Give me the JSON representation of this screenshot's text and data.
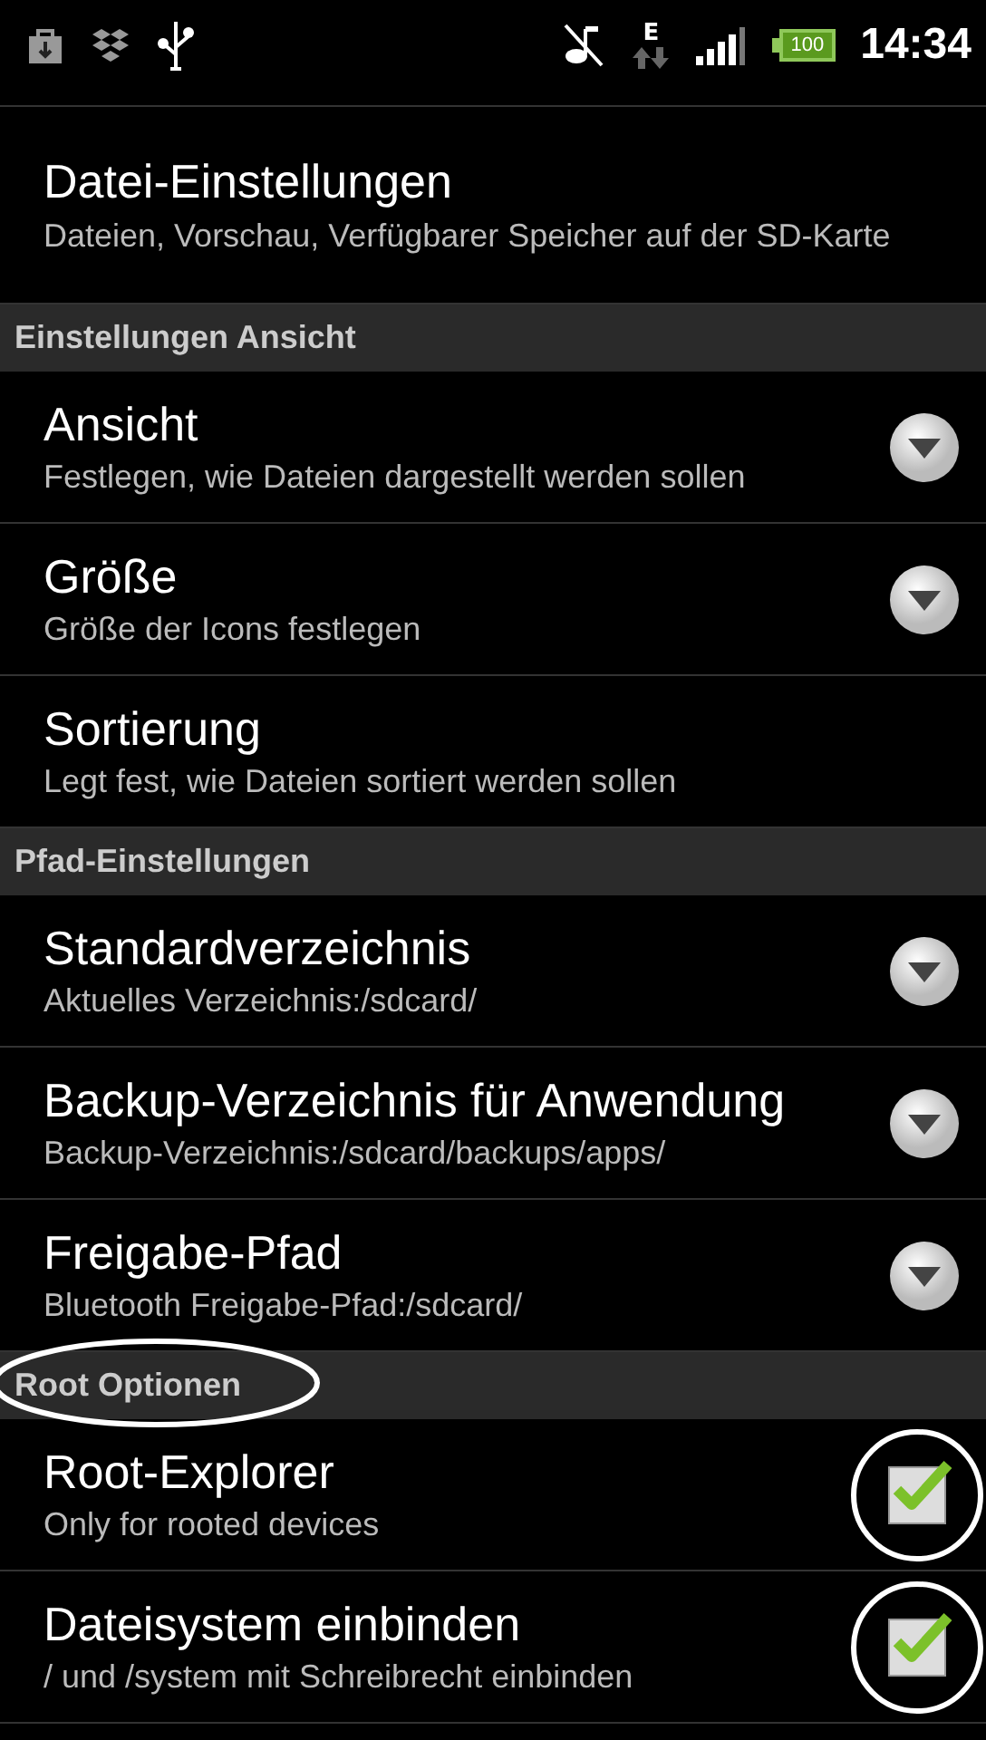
{
  "status_bar": {
    "network": "E",
    "battery": "100",
    "time": "14:34"
  },
  "items": [
    {
      "kind": "pref",
      "title": "Datei-Einstellungen",
      "summary": "Dateien, Vorschau, Verfügbarer Speicher auf der SD-Karte"
    },
    {
      "kind": "header",
      "title": "Einstellungen Ansicht",
      "circled": false
    },
    {
      "kind": "list",
      "title": "Ansicht",
      "summary": "Festlegen, wie Dateien dargestellt werden sollen"
    },
    {
      "kind": "list",
      "title": "Größe",
      "summary": "Größe der Icons festlegen"
    },
    {
      "kind": "pref",
      "title": "Sortierung",
      "summary": "Legt fest, wie Dateien sortiert werden sollen"
    },
    {
      "kind": "header",
      "title": "Pfad-Einstellungen",
      "circled": false
    },
    {
      "kind": "list",
      "title": "Standardverzeichnis",
      "summary": "Aktuelles Verzeichnis:/sdcard/"
    },
    {
      "kind": "list",
      "title": "Backup-Verzeichnis für Anwendung",
      "summary": "Backup-Verzeichnis:/sdcard/backups/apps/"
    },
    {
      "kind": "list",
      "title": "Freigabe-Pfad",
      "summary": "Bluetooth Freigabe-Pfad:/sdcard/"
    },
    {
      "kind": "header",
      "title": "Root Optionen",
      "circled": true
    },
    {
      "kind": "checkbox",
      "title": "Root-Explorer",
      "summary": "Only for rooted devices",
      "checked": true,
      "circled": true
    },
    {
      "kind": "checkbox",
      "title": "Dateisystem einbinden",
      "summary": "/ und /system mit Schreibrecht einbinden",
      "checked": true,
      "circled": true
    }
  ]
}
